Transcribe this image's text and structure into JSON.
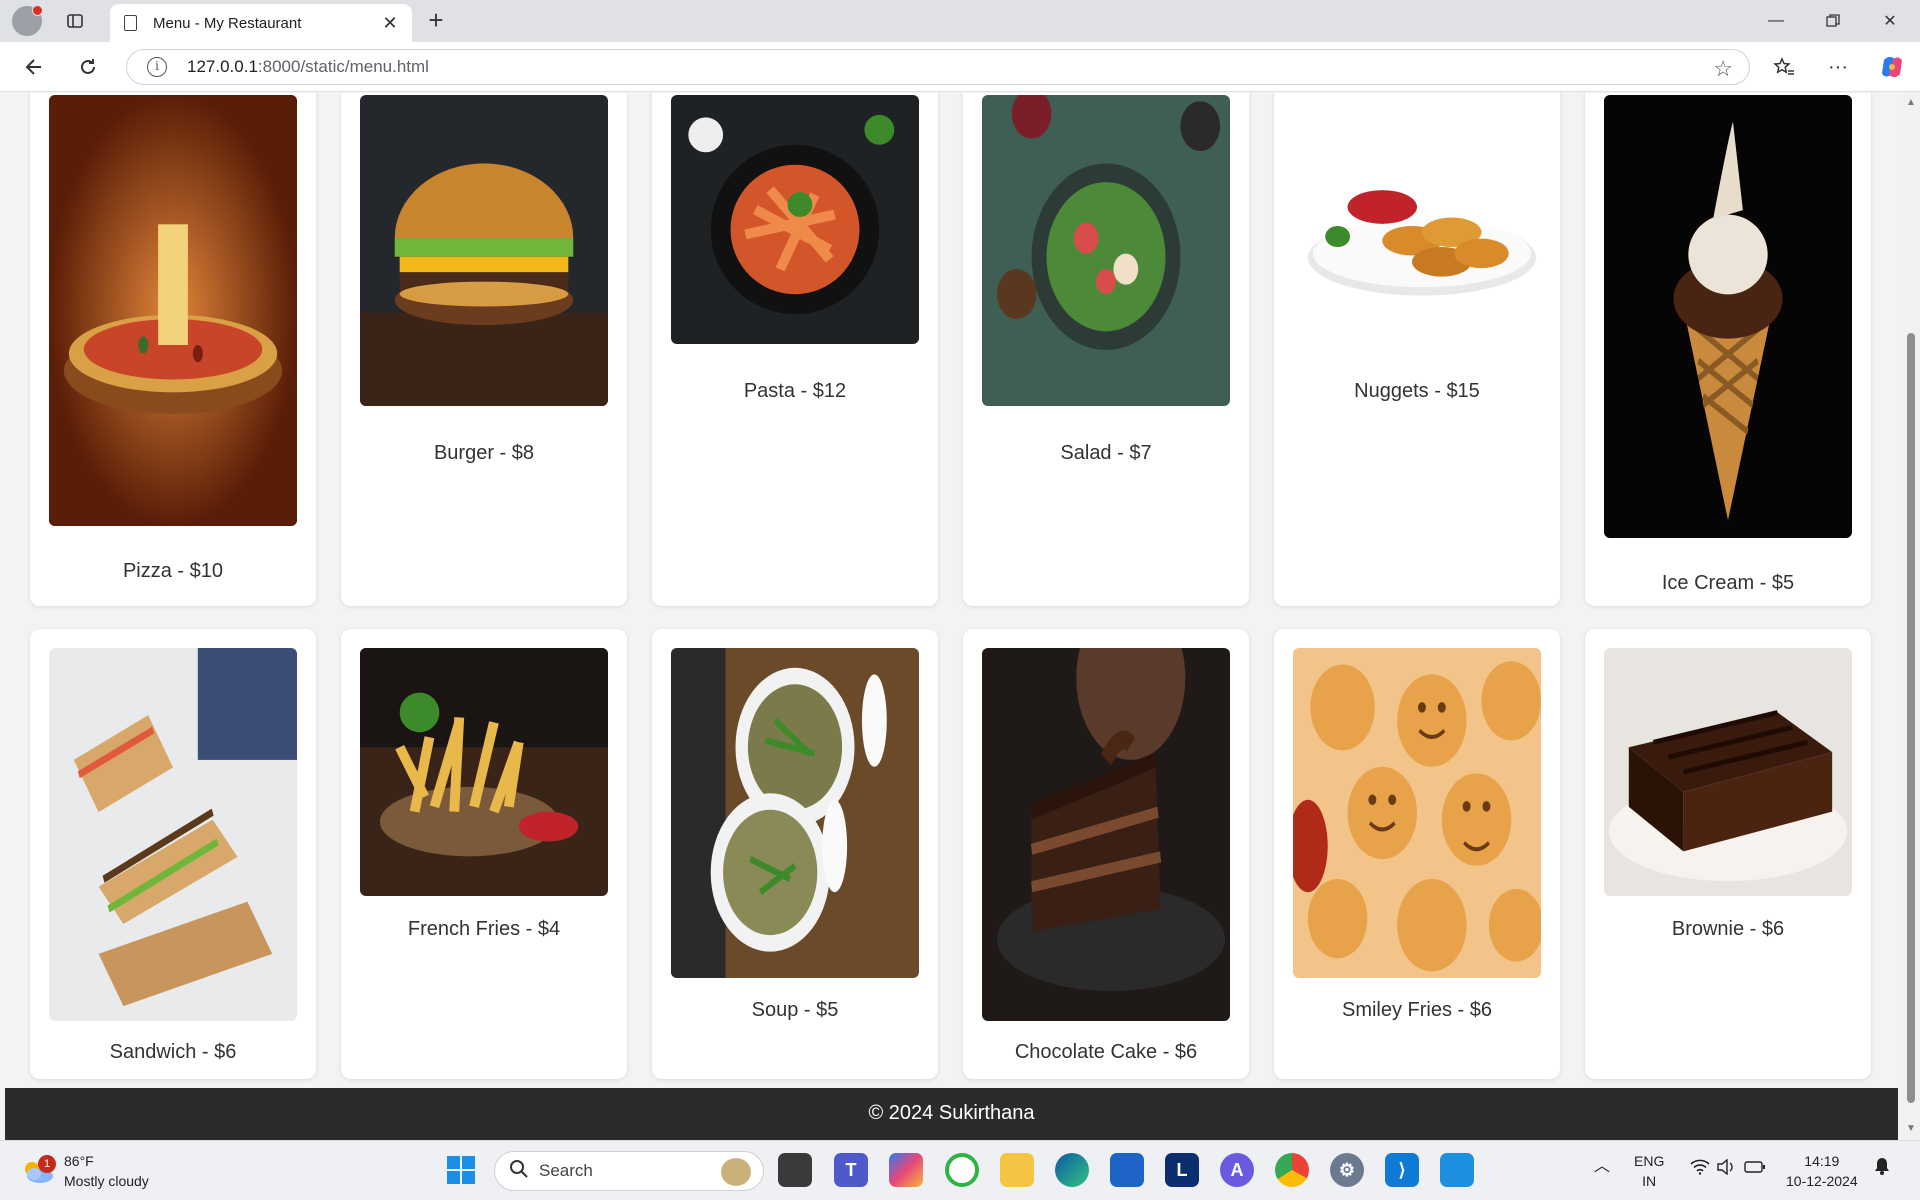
{
  "browser": {
    "tab_title": "Menu - My Restaurant",
    "url_host": "127.0.0.1",
    "url_rest": ":8000/static/menu.html"
  },
  "menu": {
    "items": [
      {
        "caption": "Pizza - $10",
        "theme": "pizza"
      },
      {
        "caption": "Burger - $8",
        "theme": "burger"
      },
      {
        "caption": "Pasta - $12",
        "theme": "pasta"
      },
      {
        "caption": "Salad - $7",
        "theme": "salad"
      },
      {
        "caption": "Nuggets - $15",
        "theme": "nuggets"
      },
      {
        "caption": "Ice Cream - $5",
        "theme": "icecream"
      },
      {
        "caption": "Sandwich - $6",
        "theme": "sandwich"
      },
      {
        "caption": "French Fries - $4",
        "theme": "fries"
      },
      {
        "caption": "Soup - $5",
        "theme": "soup"
      },
      {
        "caption": "Chocolate Cake - $6",
        "theme": "cake"
      },
      {
        "caption": "Smiley Fries - $6",
        "theme": "smiley"
      },
      {
        "caption": "Brownie - $6",
        "theme": "brownie"
      }
    ]
  },
  "footer": {
    "text": "© 2024 Sukirthana"
  },
  "taskbar": {
    "weather_temp": "86°F",
    "weather_desc": "Mostly cloudy",
    "weather_badge": "1",
    "search_label": "Search",
    "lang_line1": "ENG",
    "lang_line2": "IN",
    "time": "14:19",
    "date": "10-12-2024"
  }
}
